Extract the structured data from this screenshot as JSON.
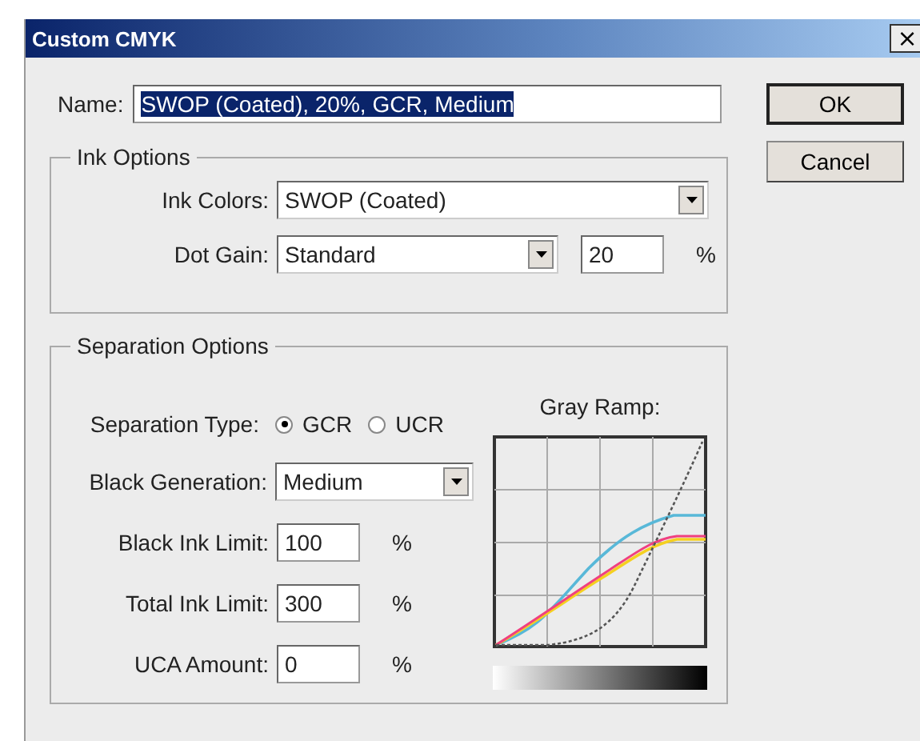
{
  "window": {
    "title": "Custom CMYK",
    "close": "×"
  },
  "name": {
    "label": "Name:",
    "value": "SWOP (Coated), 20%, GCR, Medium",
    "selected": true
  },
  "buttons": [
    {
      "label": "OK",
      "default": true
    },
    {
      "label": "Cancel",
      "default": false
    }
  ],
  "ink_options": {
    "title": "Ink Options",
    "ink_colors": {
      "label": "Ink Colors:",
      "value": "SWOP (Coated)"
    },
    "dot_gain": {
      "label": "Dot Gain:",
      "value": "Standard",
      "amount": "20",
      "unit": "%"
    }
  },
  "separation_options": {
    "title": "Separation Options",
    "separation_type": {
      "label": "Separation Type:",
      "options": [
        {
          "label": "GCR",
          "selected": true
        },
        {
          "label": "UCR",
          "selected": false
        }
      ]
    },
    "black_generation": {
      "label": "Black Generation:",
      "value": "Medium"
    },
    "fields": [
      {
        "label": "Black Ink Limit:",
        "value": "100",
        "unit": "%"
      },
      {
        "label": "Total Ink Limit:",
        "value": "300",
        "unit": "%"
      },
      {
        "label": "UCA Amount:",
        "value": "0",
        "unit": "%"
      }
    ],
    "gray_ramp": {
      "label": "Gray Ramp:"
    }
  }
}
